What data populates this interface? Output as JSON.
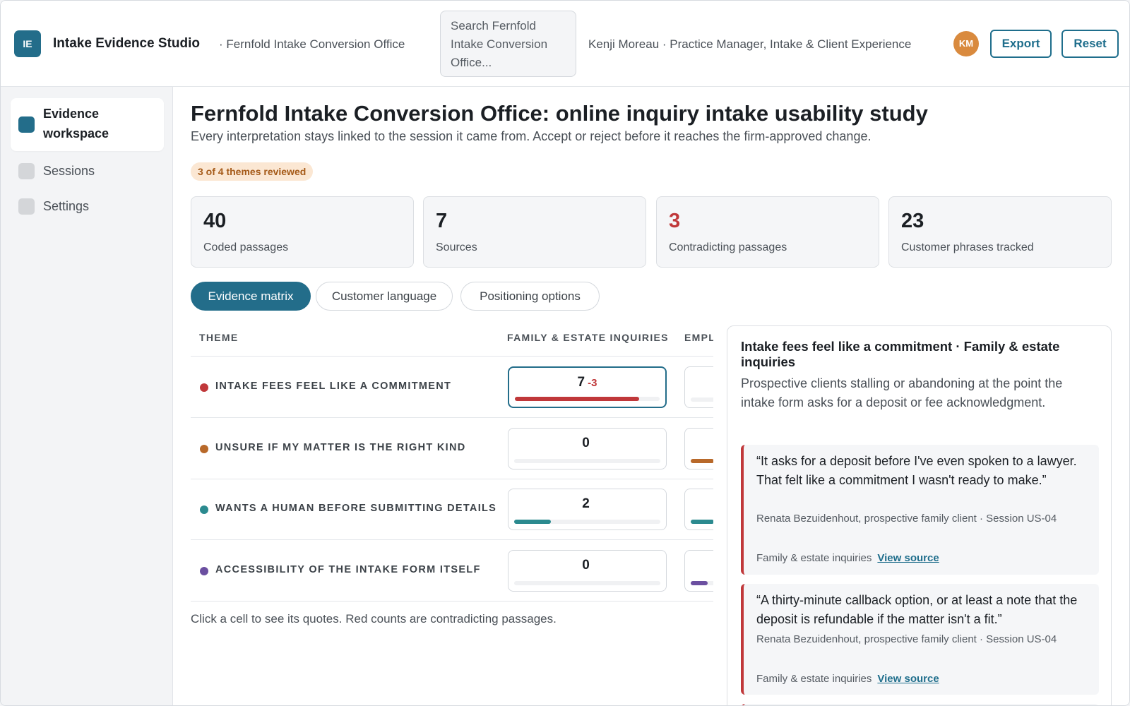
{
  "header": {
    "logo": "IE",
    "app_title": "Intake Evidence Studio",
    "org": "· Fernfold Intake Conversion Office",
    "search_placeholder": "Search Fernfold Intake Conversion Office...",
    "user": "Kenji Moreau · Practice Manager, Intake & Client Experience",
    "avatar": "KM",
    "export_label": "Export",
    "reset_label": "Reset"
  },
  "sidebar": {
    "items": [
      {
        "label": "Evidence workspace",
        "active": true
      },
      {
        "label": "Sessions",
        "active": false
      },
      {
        "label": "Settings",
        "active": false
      }
    ]
  },
  "main": {
    "title": "Fernfold Intake Conversion Office: online inquiry intake usability study",
    "subtitle": "Every interpretation stays linked to the session it came from. Accept or reject before it reaches the firm-approved change.",
    "review_badge": "3 of 4 themes reviewed",
    "stats": [
      {
        "value": "40",
        "label": "Coded passages"
      },
      {
        "value": "7",
        "label": "Sources"
      },
      {
        "value": "3",
        "label": "Contradicting passages"
      },
      {
        "value": "23",
        "label": "Customer phrases tracked"
      }
    ],
    "tabs": [
      {
        "label": "Evidence matrix",
        "active": true
      },
      {
        "label": "Customer language",
        "active": false
      },
      {
        "label": "Positioning options",
        "active": false
      }
    ]
  },
  "matrix": {
    "headers": [
      "THEME",
      "FAMILY & ESTATE INQUIRIES",
      "EMPL"
    ],
    "rows": [
      {
        "theme": "INTAKE FEES FEEL LIKE A COMMITMENT",
        "color": "#c0383a",
        "count": "7",
        "contra": "-3",
        "fill": 0.86,
        "fill2": 0.0
      },
      {
        "theme": "UNSURE IF MY MATTER IS THE RIGHT KIND",
        "color": "#b8692a",
        "count": "0",
        "contra": "",
        "fill": 0.0,
        "fill2": 0.55
      },
      {
        "theme": "WANTS A HUMAN BEFORE SUBMITTING DETAILS",
        "color": "#2b8a8f",
        "count": "2",
        "contra": "",
        "fill": 0.25,
        "fill2": 0.55
      },
      {
        "theme": "ACCESSIBILITY OF THE INTAKE FORM ITSELF",
        "color": "#6b4fa0",
        "count": "0",
        "contra": "",
        "fill": 0.0,
        "fill2": 0.4
      }
    ],
    "footnote": "Click a cell to see its quotes. Red counts are contradicting passages."
  },
  "detail": {
    "title": "Intake fees feel like a commitment · Family & estate inquiries",
    "description": "Prospective clients stalling or abandoning at the point the intake form asks for a deposit or fee acknowledgment.",
    "quotes": [
      {
        "text": "“It asks for a deposit before I've even spoken to a lawyer. That felt like a commitment I wasn't ready to make.”",
        "attribution": "Renata Bezuidenhout, prospective family client · Session US-04",
        "segment": "Family & estate inquiries",
        "link": "View source"
      },
      {
        "text": "“A thirty-minute callback option, or at least a note that the deposit is refundable if the matter isn't a fit.”",
        "attribution": "Renata Bezuidenhout, prospective family client · Session US-04",
        "segment": "Family & estate inquiries",
        "link": "View source"
      }
    ]
  },
  "colors": {
    "accent": "#236d8a",
    "contradiction": "#c0383a",
    "badge_bg": "#fbe7d3",
    "badge_text": "#a55a18"
  }
}
